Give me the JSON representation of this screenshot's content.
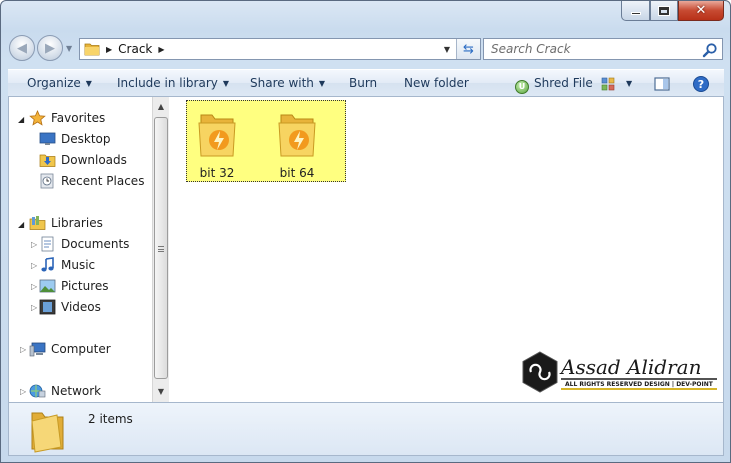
{
  "window": {
    "caption": {
      "minimize_icon": "minimize-icon",
      "maximize_icon": "maximize-icon",
      "close_icon": "close-icon"
    }
  },
  "nav": {
    "back_icon": "back-arrow-icon",
    "forward_icon": "forward-arrow-icon",
    "address": {
      "path": "Crack",
      "folder_icon": "folder-icon"
    },
    "search": {
      "placeholder": "Search Crack"
    }
  },
  "toolbar": {
    "organize": "Organize",
    "include_in_library": "Include in library",
    "share_with": "Share with",
    "burn": "Burn",
    "new_folder": "New folder",
    "shred_file": "Shred File",
    "shred_icon_letter": "U"
  },
  "sidebar": {
    "favorites": {
      "label": "Favorites",
      "items": [
        {
          "label": "Desktop"
        },
        {
          "label": "Downloads"
        },
        {
          "label": "Recent Places"
        }
      ]
    },
    "libraries": {
      "label": "Libraries",
      "items": [
        {
          "label": "Documents"
        },
        {
          "label": "Music"
        },
        {
          "label": "Pictures"
        },
        {
          "label": "Videos"
        }
      ]
    },
    "computer": {
      "label": "Computer"
    },
    "network": {
      "label": "Network"
    }
  },
  "files": {
    "items": [
      {
        "name": "bit 32",
        "icon": "folder-lightning-icon"
      },
      {
        "name": "bit 64",
        "icon": "folder-lightning-icon"
      }
    ]
  },
  "watermark": {
    "name": "Assad Alidran",
    "tagline": "ALL RIGHTS RESERVED DESIGN | DEV-POINT"
  },
  "details": {
    "count": "2 items"
  },
  "colors": {
    "selection": "#ffff80",
    "command_text": "#1e395b",
    "folder_yellow": "#f5c73a",
    "close_red": "#c74a32"
  }
}
